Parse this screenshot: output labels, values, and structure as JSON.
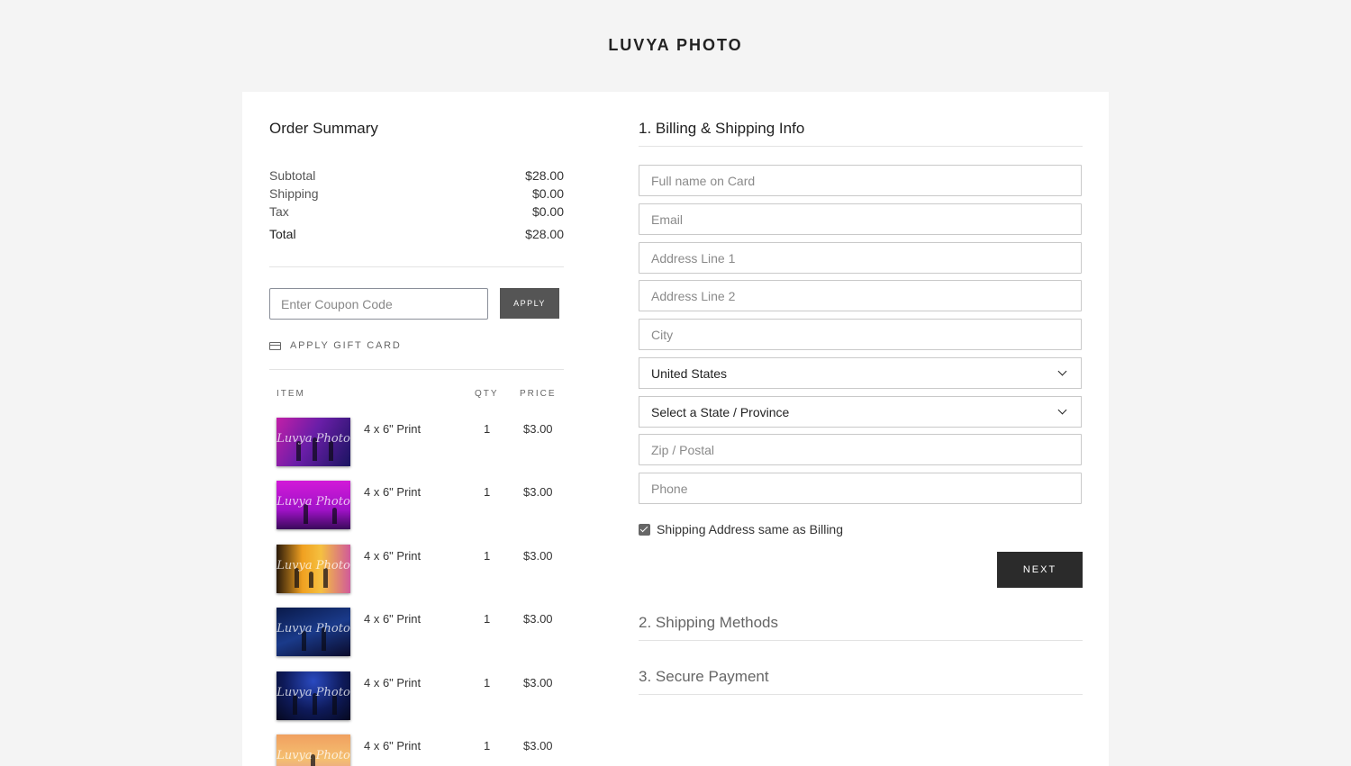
{
  "brand": "LUVYA PHOTO",
  "summary": {
    "title": "Order Summary",
    "rows": [
      {
        "label": "Subtotal",
        "value": "$28.00"
      },
      {
        "label": "Shipping",
        "value": "$0.00"
      },
      {
        "label": "Tax",
        "value": "$0.00"
      }
    ],
    "total": {
      "label": "Total",
      "value": "$28.00"
    }
  },
  "coupon": {
    "placeholder": "Enter Coupon Code",
    "apply_label": "APPLY"
  },
  "gift_card_label": "APPLY GIFT CARD",
  "table": {
    "headers": {
      "item": "ITEM",
      "qty": "QTY",
      "price": "PRICE"
    },
    "items": [
      {
        "name": "4 x 6\" Print",
        "qty": "1",
        "price": "$3.00",
        "watermark": "Luvya Photo"
      },
      {
        "name": "4 x 6\" Print",
        "qty": "1",
        "price": "$3.00",
        "watermark": "Luvya Photo"
      },
      {
        "name": "4 x 6\" Print",
        "qty": "1",
        "price": "$3.00",
        "watermark": "Luvya Photo"
      },
      {
        "name": "4 x 6\" Print",
        "qty": "1",
        "price": "$3.00",
        "watermark": "Luvya Photo"
      },
      {
        "name": "4 x 6\" Print",
        "qty": "1",
        "price": "$3.00",
        "watermark": "Luvya Photo"
      },
      {
        "name": "4 x 6\" Print",
        "qty": "1",
        "price": "$3.00",
        "watermark": "Luvya Photo"
      }
    ]
  },
  "billing": {
    "title": "1. Billing & Shipping Info",
    "full_name_placeholder": "Full name on Card",
    "email_placeholder": "Email",
    "address1_placeholder": "Address Line 1",
    "address2_placeholder": "Address Line 2",
    "city_placeholder": "City",
    "country_value": "United States",
    "state_value": "Select a State / Province",
    "zip_placeholder": "Zip / Postal",
    "phone_placeholder": "Phone",
    "same_address_label": "Shipping Address same as Billing",
    "same_address_checked": true,
    "next_label": "NEXT"
  },
  "steps": {
    "shipping_methods": "2. Shipping Methods",
    "secure_payment": "3. Secure Payment"
  },
  "colors": {
    "page_bg": "#f4f4f4",
    "button_dark": "#2b2b2b",
    "button_grey": "#555555"
  }
}
